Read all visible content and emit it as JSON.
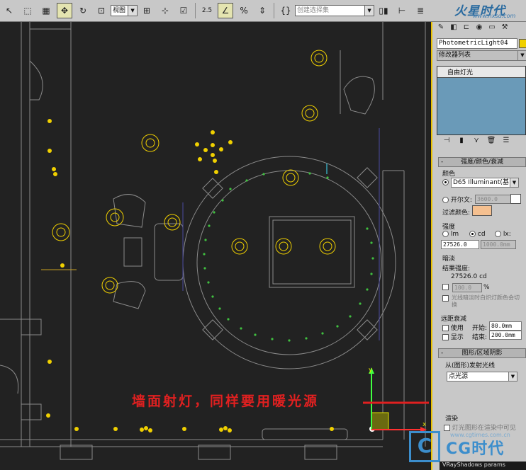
{
  "toolbar": {
    "view_select": "视图",
    "selection_set": "创建选择集",
    "snap_label": "2.5",
    "active_tool": "select-move"
  },
  "logo": {
    "text": "火星时代",
    "url": "www.hxsd.com"
  },
  "viewport": {
    "annotation": "墙面射灯，同样要用暖光源",
    "axis_x": "x",
    "axis_y": "y"
  },
  "panel": {
    "object_name": "PhotometricLight04",
    "object_color": "#f0d000",
    "modifier_list": "修改器列表",
    "stack_item": "自由灯光",
    "rollout_intensity": "强度/颜色/衰减",
    "color_label": "颜色",
    "color_preset": "D65 Illuminant(基",
    "kelvin_label": "开尔文:",
    "kelvin_value": "3600.0",
    "filter_color_label": "过滤颜色:",
    "filter_color": "#f5c090",
    "kelvin_swatch": "#ffffff",
    "intensity_label": "强度",
    "unit_lm": "lm",
    "unit_cd": "cd",
    "unit_lx": "lx:",
    "intensity_value": "27526.0",
    "distance_value": "1000.0mm",
    "dimming_label": "暗淡",
    "result_intensity_label": "结果强度:",
    "result_intensity": "27526.0  cd",
    "dim_percent": "100.0",
    "percent_sign": "%",
    "dim_check_text": "光线暗淡时白炽灯颜色会切换",
    "far_atten_label": "远距衰减",
    "use_label": "使用",
    "start_label": "开始:",
    "start_value": "80.0mm",
    "show_label": "显示",
    "end_label": "结束:",
    "end_value": "200.0mm",
    "rollout_shape": "图形/区域阴影",
    "emit_from_label": "从(图形)发射光线",
    "shape_select": "点光源",
    "render_label": "渲染",
    "render_check_text": "灯光图形在渲染中可见",
    "bottom_item": "VRayShadows params"
  },
  "watermark": {
    "brand": "CG时代",
    "site": "www.cgtimes.com.cn"
  }
}
